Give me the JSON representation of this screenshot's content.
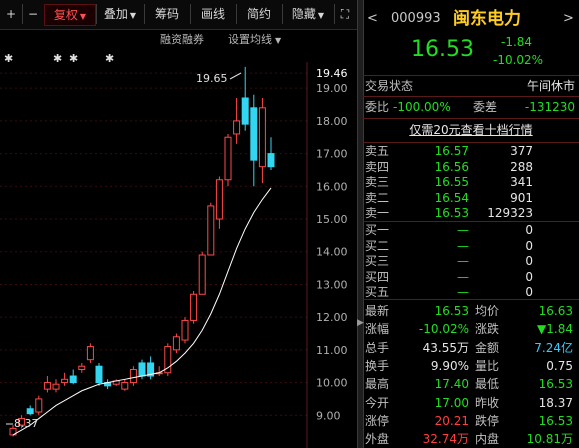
{
  "toolbar": {
    "plus_icon": "plus-icon",
    "minus_icon": "minus-icon",
    "fuquan": "复权",
    "diejia": "叠加",
    "chouma": "筹码",
    "huaxian": "画线",
    "jianyue": "简约",
    "yincang": "隐藏",
    "more_icon": "expand-icon"
  },
  "subbar": {
    "margin": "融资融券",
    "settings": "设置均线"
  },
  "chart": {
    "high_label": "19.65",
    "low_label": "8.37",
    "y_ticks": [
      "19.46",
      "19.00",
      "18.00",
      "17.00",
      "16.00",
      "15.00",
      "14.00",
      "13.00",
      "12.00",
      "11.00",
      "10.00",
      "9.00"
    ],
    "colors": {
      "up": "#ff4a4a",
      "down": "#33d6f0",
      "ma": "#ffffff"
    },
    "candles": [
      {
        "o": 8.4,
        "c": 8.6,
        "h": 8.7,
        "l": 8.35
      },
      {
        "o": 8.7,
        "c": 8.9,
        "h": 9.0,
        "l": 8.6
      },
      {
        "o": 9.2,
        "c": 9.05,
        "h": 9.3,
        "l": 9.0
      },
      {
        "o": 9.1,
        "c": 9.5,
        "h": 9.6,
        "l": 9.0
      },
      {
        "o": 9.8,
        "c": 10.0,
        "h": 10.2,
        "l": 9.7
      },
      {
        "o": 9.8,
        "c": 9.95,
        "h": 10.1,
        "l": 9.7
      },
      {
        "o": 10.0,
        "c": 10.1,
        "h": 10.3,
        "l": 9.9
      },
      {
        "o": 10.2,
        "c": 10.0,
        "h": 10.4,
        "l": 9.95
      },
      {
        "o": 10.4,
        "c": 10.5,
        "h": 10.6,
        "l": 10.3
      },
      {
        "o": 10.7,
        "c": 11.1,
        "h": 11.2,
        "l": 10.6
      },
      {
        "o": 10.5,
        "c": 10.0,
        "h": 10.6,
        "l": 9.9
      },
      {
        "o": 10.0,
        "c": 9.9,
        "h": 10.1,
        "l": 9.8
      },
      {
        "o": 9.95,
        "c": 10.05,
        "h": 10.1,
        "l": 9.9
      },
      {
        "o": 9.8,
        "c": 10.0,
        "h": 10.1,
        "l": 9.75
      },
      {
        "o": 10.0,
        "c": 10.4,
        "h": 10.5,
        "l": 9.9
      },
      {
        "o": 10.6,
        "c": 10.2,
        "h": 10.7,
        "l": 10.1
      },
      {
        "o": 10.6,
        "c": 10.2,
        "h": 10.8,
        "l": 10.1
      },
      {
        "o": 10.3,
        "c": 10.3,
        "h": 10.5,
        "l": 10.2
      },
      {
        "o": 10.3,
        "c": 11.1,
        "h": 11.2,
        "l": 10.2
      },
      {
        "o": 11.0,
        "c": 11.4,
        "h": 11.5,
        "l": 10.9
      },
      {
        "o": 11.3,
        "c": 11.9,
        "h": 12.0,
        "l": 11.2
      },
      {
        "o": 11.9,
        "c": 12.7,
        "h": 12.8,
        "l": 11.8
      },
      {
        "o": 12.7,
        "c": 13.9,
        "h": 14.0,
        "l": 12.7
      },
      {
        "o": 13.9,
        "c": 15.4,
        "h": 15.5,
        "l": 13.9
      },
      {
        "o": 15.0,
        "c": 16.2,
        "h": 16.3,
        "l": 14.7
      },
      {
        "o": 16.2,
        "c": 17.5,
        "h": 17.6,
        "l": 16.0
      },
      {
        "o": 17.6,
        "c": 18.0,
        "h": 18.7,
        "l": 17.3
      },
      {
        "o": 18.7,
        "c": 17.9,
        "h": 19.65,
        "l": 17.7
      },
      {
        "o": 18.4,
        "c": 16.8,
        "h": 18.8,
        "l": 16.0
      },
      {
        "o": 16.6,
        "c": 18.4,
        "h": 18.7,
        "l": 16.1
      },
      {
        "o": 17.0,
        "c": 16.6,
        "h": 17.5,
        "l": 16.5
      }
    ],
    "ma_values": [
      8.4,
      8.55,
      8.7,
      8.9,
      9.1,
      9.3,
      9.45,
      9.6,
      9.75,
      9.85,
      9.95,
      10.0,
      10.05,
      10.1,
      10.15,
      10.2,
      10.25,
      10.3,
      10.45,
      10.65,
      10.9,
      11.2,
      11.6,
      12.1,
      12.7,
      13.4,
      14.1,
      14.7,
      15.2,
      15.6,
      15.95
    ]
  },
  "quote": {
    "code": "000993",
    "name": "闽东电力",
    "price": "16.53",
    "change": "-1.84",
    "change_pct": "-10.02%",
    "trade_status_label": "交易状态",
    "trade_status_value": "午间休市",
    "weibi_label": "委比",
    "weibi_value": "-100.00%",
    "weicha_label": "委差",
    "weicha_value": "-131230",
    "promo": "仅需20元查看十档行情"
  },
  "asks": [
    {
      "label": "卖五",
      "price": "16.57",
      "vol": "377"
    },
    {
      "label": "卖四",
      "price": "16.56",
      "vol": "288"
    },
    {
      "label": "卖三",
      "price": "16.55",
      "vol": "341"
    },
    {
      "label": "卖二",
      "price": "16.54",
      "vol": "901"
    },
    {
      "label": "卖一",
      "price": "16.53",
      "vol": "129323"
    }
  ],
  "bids": [
    {
      "label": "买一",
      "price": "—",
      "vol": "0"
    },
    {
      "label": "买二",
      "price": "—",
      "vol": "0"
    },
    {
      "label": "买三",
      "price": "—",
      "vol": "0"
    },
    {
      "label": "买四",
      "price": "—",
      "vol": "0"
    },
    {
      "label": "买五",
      "price": "—",
      "vol": "0"
    }
  ],
  "stats": [
    {
      "l1": "最新",
      "v1": "16.53",
      "c1": "green",
      "l2": "均价",
      "v2": "16.63",
      "c2": "green"
    },
    {
      "l1": "涨幅",
      "v1": "-10.02%",
      "c1": "green",
      "l2": "涨跌",
      "v2": "▼1.84",
      "c2": "green"
    },
    {
      "l1": "总手",
      "v1": "43.55万",
      "c1": "white",
      "l2": "金额",
      "v2": "7.24亿",
      "c2": "cyan"
    },
    {
      "l1": "换手",
      "v1": "9.90%",
      "c1": "white",
      "l2": "量比",
      "v2": "0.75",
      "c2": "white"
    },
    {
      "l1": "最高",
      "v1": "17.40",
      "c1": "green",
      "l2": "最低",
      "v2": "16.53",
      "c2": "green"
    },
    {
      "l1": "今开",
      "v1": "17.00",
      "c1": "green",
      "l2": "昨收",
      "v2": "18.37",
      "c2": "white"
    },
    {
      "l1": "涨停",
      "v1": "20.21",
      "c1": "red",
      "l2": "跌停",
      "v2": "16.53",
      "c2": "green"
    },
    {
      "l1": "外盘",
      "v1": "32.74万",
      "c1": "red",
      "l2": "内盘",
      "v2": "10.81万",
      "c2": "green"
    }
  ]
}
